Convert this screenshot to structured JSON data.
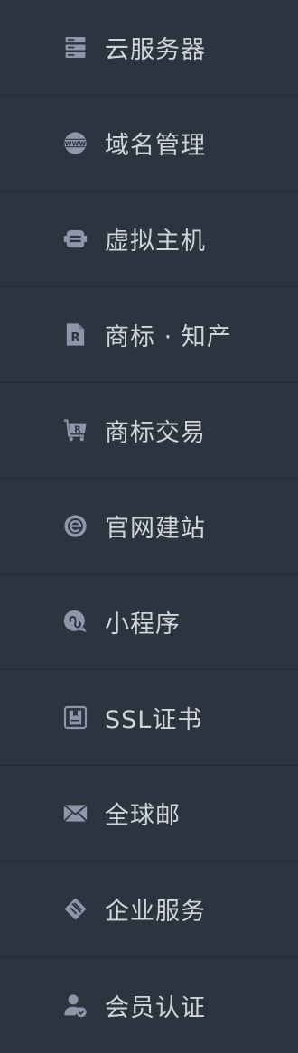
{
  "menu": {
    "items": [
      {
        "label": "云服务器",
        "icon": "server-icon"
      },
      {
        "label": "域名管理",
        "icon": "globe-icon"
      },
      {
        "label": "虚拟主机",
        "icon": "virtual-host-icon"
      },
      {
        "label": "商标 · 知产",
        "icon": "trademark-document-icon"
      },
      {
        "label": "商标交易",
        "icon": "trademark-cart-icon"
      },
      {
        "label": "官网建站",
        "icon": "website-builder-icon"
      },
      {
        "label": "小程序",
        "icon": "mini-program-icon"
      },
      {
        "label": "SSL证书",
        "icon": "ssl-certificate-icon"
      },
      {
        "label": "全球邮",
        "icon": "mail-icon"
      },
      {
        "label": "企业服务",
        "icon": "enterprise-service-icon"
      },
      {
        "label": "会员认证",
        "icon": "member-verification-icon"
      }
    ]
  },
  "colors": {
    "background": "#2c3440",
    "divider": "#252c37",
    "text": "#d0d4da",
    "icon": "#8d97aa"
  }
}
